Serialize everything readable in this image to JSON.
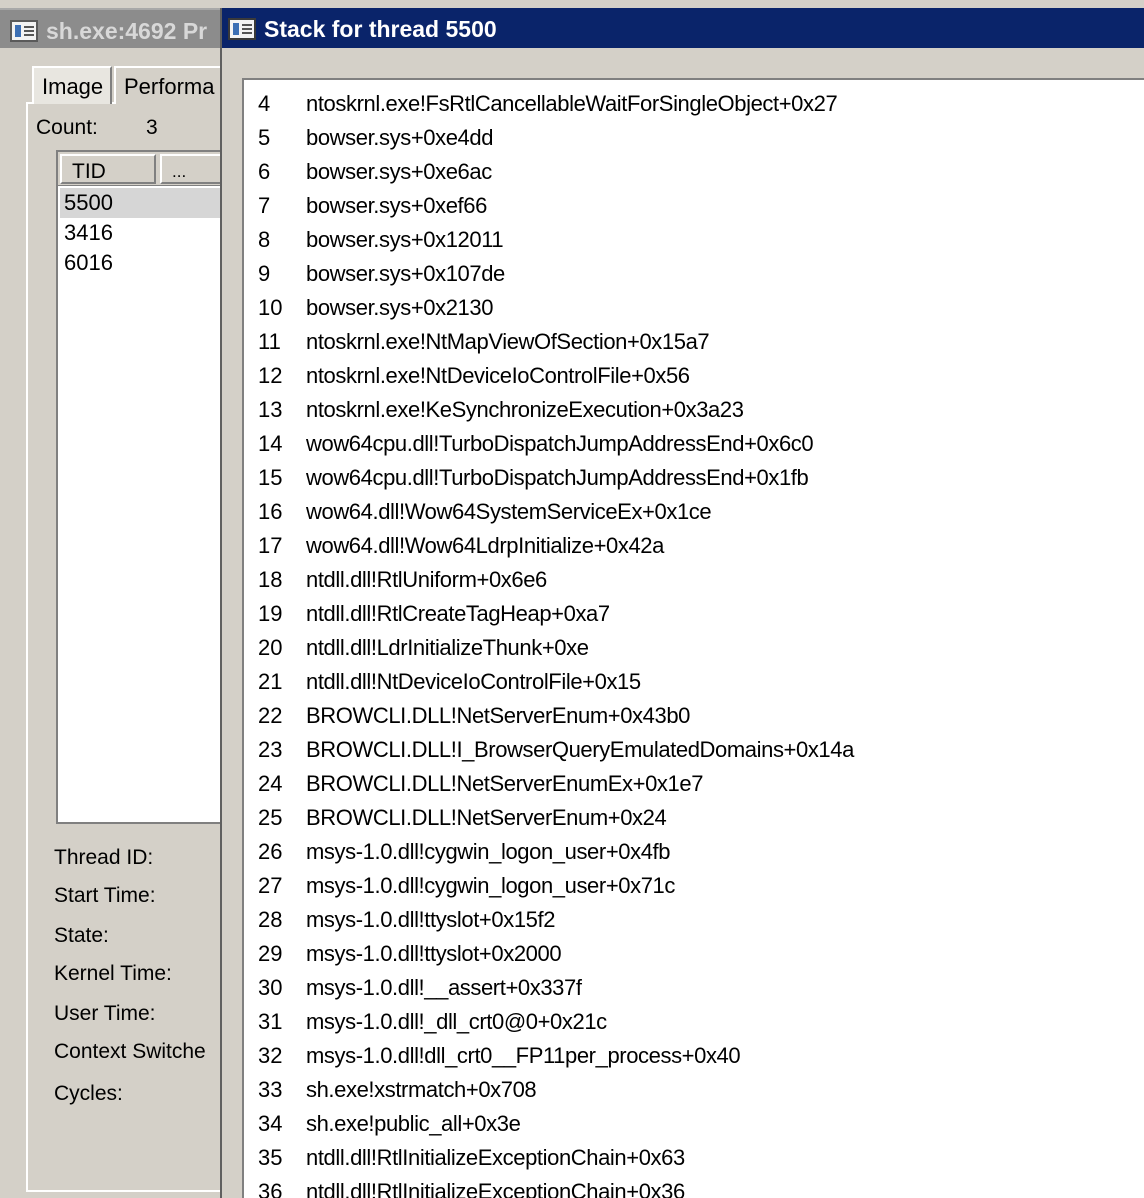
{
  "background_window": {
    "title": "sh.exe:4692 Pr",
    "tabs": [
      "Image",
      "Performa"
    ],
    "count_label": "Count:",
    "count_value": "3",
    "thread_list": {
      "columns": [
        "TID",
        "..."
      ],
      "rows": [
        "5500",
        "3416",
        "6016"
      ],
      "selected": "5500"
    },
    "fields": [
      "Thread ID:",
      "Start Time:",
      "State:",
      "Kernel Time:",
      "User Time:",
      "Context Switche",
      "Cycles:"
    ]
  },
  "stack_window": {
    "title": "Stack for thread 5500",
    "frames": [
      {
        "n": "4",
        "symbol": "ntoskrnl.exe!FsRtlCancellableWaitForSingleObject+0x27"
      },
      {
        "n": "5",
        "symbol": "bowser.sys+0xe4dd"
      },
      {
        "n": "6",
        "symbol": "bowser.sys+0xe6ac"
      },
      {
        "n": "7",
        "symbol": "bowser.sys+0xef66"
      },
      {
        "n": "8",
        "symbol": "bowser.sys+0x12011"
      },
      {
        "n": "9",
        "symbol": "bowser.sys+0x107de"
      },
      {
        "n": "10",
        "symbol": "bowser.sys+0x2130"
      },
      {
        "n": "11",
        "symbol": "ntoskrnl.exe!NtMapViewOfSection+0x15a7"
      },
      {
        "n": "12",
        "symbol": "ntoskrnl.exe!NtDeviceIoControlFile+0x56"
      },
      {
        "n": "13",
        "symbol": "ntoskrnl.exe!KeSynchronizeExecution+0x3a23"
      },
      {
        "n": "14",
        "symbol": "wow64cpu.dll!TurboDispatchJumpAddressEnd+0x6c0"
      },
      {
        "n": "15",
        "symbol": "wow64cpu.dll!TurboDispatchJumpAddressEnd+0x1fb"
      },
      {
        "n": "16",
        "symbol": "wow64.dll!Wow64SystemServiceEx+0x1ce"
      },
      {
        "n": "17",
        "symbol": "wow64.dll!Wow64LdrpInitialize+0x42a"
      },
      {
        "n": "18",
        "symbol": "ntdll.dll!RtlUniform+0x6e6"
      },
      {
        "n": "19",
        "symbol": "ntdll.dll!RtlCreateTagHeap+0xa7"
      },
      {
        "n": "20",
        "symbol": "ntdll.dll!LdrInitializeThunk+0xe"
      },
      {
        "n": "21",
        "symbol": "ntdll.dll!NtDeviceIoControlFile+0x15"
      },
      {
        "n": "22",
        "symbol": "BROWCLI.DLL!NetServerEnum+0x43b0"
      },
      {
        "n": "23",
        "symbol": "BROWCLI.DLL!I_BrowserQueryEmulatedDomains+0x14a"
      },
      {
        "n": "24",
        "symbol": "BROWCLI.DLL!NetServerEnumEx+0x1e7"
      },
      {
        "n": "25",
        "symbol": "BROWCLI.DLL!NetServerEnum+0x24"
      },
      {
        "n": "26",
        "symbol": "msys-1.0.dll!cygwin_logon_user+0x4fb"
      },
      {
        "n": "27",
        "symbol": "msys-1.0.dll!cygwin_logon_user+0x71c"
      },
      {
        "n": "28",
        "symbol": "msys-1.0.dll!ttyslot+0x15f2"
      },
      {
        "n": "29",
        "symbol": "msys-1.0.dll!ttyslot+0x2000"
      },
      {
        "n": "30",
        "symbol": "msys-1.0.dll!__assert+0x337f"
      },
      {
        "n": "31",
        "symbol": "msys-1.0.dll!_dll_crt0@0+0x21c"
      },
      {
        "n": "32",
        "symbol": "msys-1.0.dll!dll_crt0__FP11per_process+0x40"
      },
      {
        "n": "33",
        "symbol": "sh.exe!xstrmatch+0x708"
      },
      {
        "n": "34",
        "symbol": "sh.exe!public_all+0x3e"
      },
      {
        "n": "35",
        "symbol": "ntdll.dll!RtlInitializeExceptionChain+0x63"
      },
      {
        "n": "36",
        "symbol": "ntdll.dll!RtlInitializeExceptionChain+0x36"
      }
    ]
  },
  "colors": {
    "active_title": "#0a246a",
    "inactive_title": "#8c8c8c",
    "face": "#d4d0c8",
    "list_bg": "#ffffff"
  }
}
